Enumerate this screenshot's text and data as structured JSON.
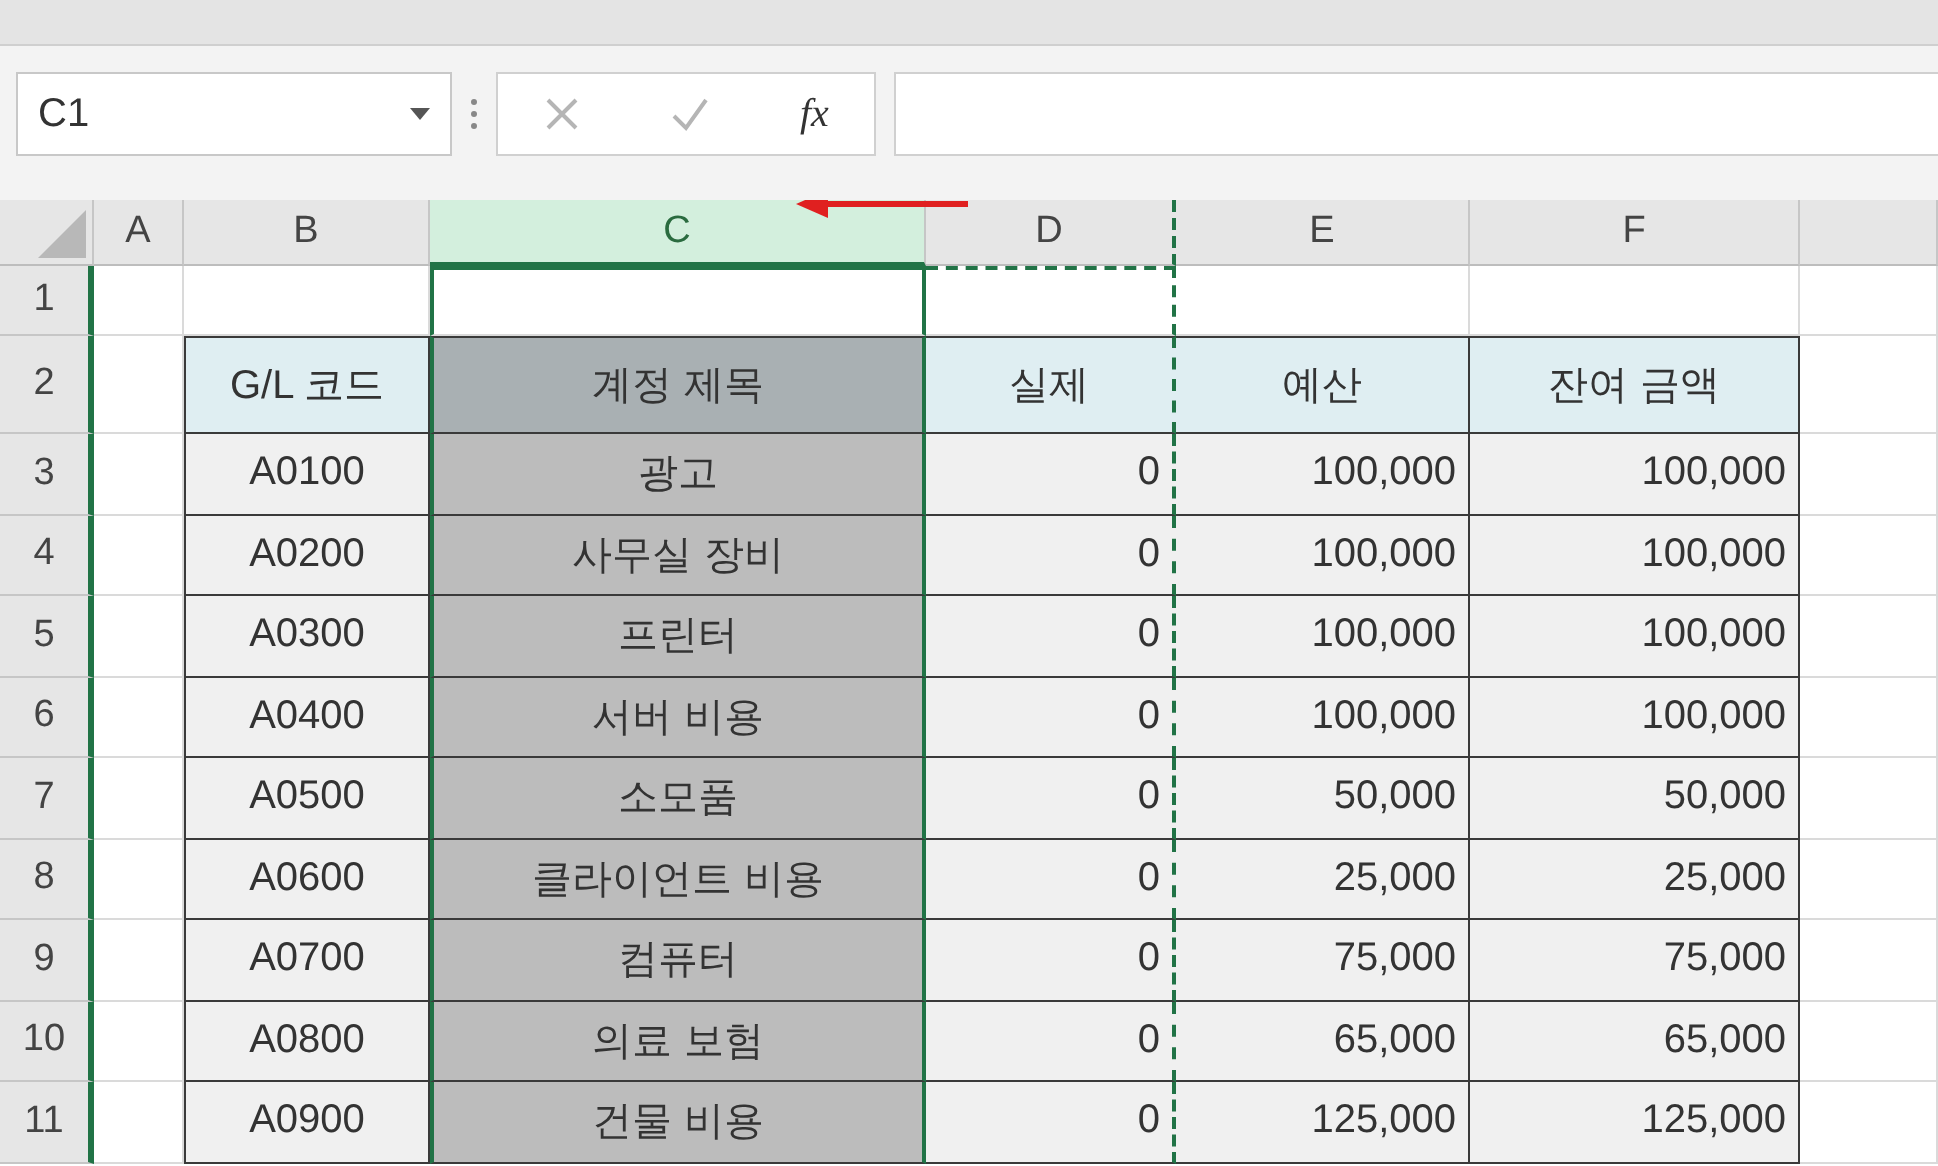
{
  "name_box": {
    "value": "C1"
  },
  "formula_bar": {
    "function_button": "fx"
  },
  "columns": [
    {
      "label": "A",
      "selected": false,
      "copied": false
    },
    {
      "label": "B",
      "selected": false,
      "copied": false
    },
    {
      "label": "C",
      "selected": true,
      "copied": false
    },
    {
      "label": "D",
      "selected": false,
      "copied": true
    },
    {
      "label": "E",
      "selected": false,
      "copied": false
    },
    {
      "label": "F",
      "selected": false,
      "copied": false
    }
  ],
  "row_headers": [
    "1",
    "2",
    "3",
    "4",
    "5",
    "6",
    "7",
    "8",
    "9",
    "10",
    "11"
  ],
  "table": {
    "header": [
      "G/L 코드",
      "계정 제목",
      "실제",
      "예산",
      "잔여 금액"
    ],
    "rows": [
      [
        "A0100",
        "광고",
        "0",
        "100,000",
        "100,000"
      ],
      [
        "A0200",
        "사무실 장비",
        "0",
        "100,000",
        "100,000"
      ],
      [
        "A0300",
        "프린터",
        "0",
        "100,000",
        "100,000"
      ],
      [
        "A0400",
        "서버 비용",
        "0",
        "100,000",
        "100,000"
      ],
      [
        "A0500",
        "소모품",
        "0",
        "50,000",
        "50,000"
      ],
      [
        "A0600",
        "클라이언트 비용",
        "0",
        "25,000",
        "25,000"
      ],
      [
        "A0700",
        "컴퓨터",
        "0",
        "75,000",
        "75,000"
      ],
      [
        "A0800",
        "의료 보험",
        "0",
        "65,000",
        "65,000"
      ],
      [
        "A0900",
        "건물 비용",
        "0",
        "125,000",
        "125,000"
      ]
    ]
  }
}
